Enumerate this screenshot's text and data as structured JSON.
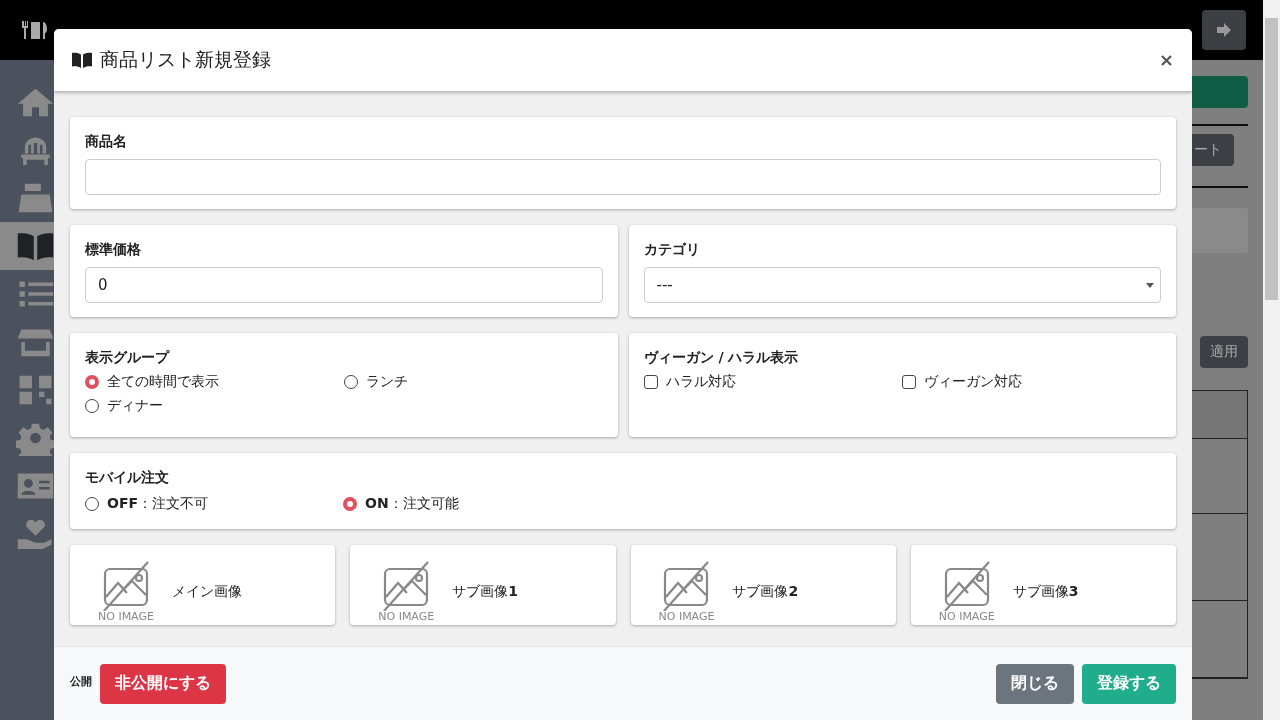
{
  "sidebar": {
    "items": [
      {
        "kind": "home",
        "selected": false
      },
      {
        "kind": "chair",
        "selected": false
      },
      {
        "kind": "register",
        "selected": false
      },
      {
        "kind": "book",
        "selected": true
      },
      {
        "kind": "list",
        "selected": false
      },
      {
        "kind": "store",
        "selected": false
      },
      {
        "kind": "qr",
        "selected": false
      },
      {
        "kind": "gear",
        "selected": false
      },
      {
        "kind": "card",
        "selected": false
      },
      {
        "kind": "heart",
        "selected": false
      }
    ]
  },
  "background": {
    "partial_button": "ート",
    "apply_button": "適用"
  },
  "modal": {
    "title": "商品リスト新規登録",
    "name_field": {
      "label": "商品名"
    },
    "price_field": {
      "label": "標準価格",
      "value": "0"
    },
    "category_field": {
      "label": "カテゴリ",
      "value": "---"
    },
    "display_group": {
      "label": "表示グループ",
      "options": [
        {
          "label": "全ての時間で表示",
          "selected": true
        },
        {
          "label": "ランチ",
          "selected": false
        },
        {
          "label": "ディナー",
          "selected": false
        }
      ]
    },
    "dietary": {
      "label": "ヴィーガン **/** ハラル表示",
      "options": [
        {
          "label": "ハラル対応",
          "checked": false
        },
        {
          "label": "ヴィーガン対応",
          "checked": false
        }
      ]
    },
    "mobile_order": {
      "label": "モバイル注文",
      "options": [
        {
          "label": "**OFF**：注文不可",
          "selected": false
        },
        {
          "label": "**ON**：注文可能",
          "selected": true
        }
      ]
    },
    "images": [
      {
        "label": "メイン画像",
        "no_image": "NO IMAGE"
      },
      {
        "label": "サブ画像**1**",
        "no_image": "NO IMAGE"
      },
      {
        "label": "サブ画像**2**",
        "no_image": "NO IMAGE"
      },
      {
        "label": "サブ画像**3**",
        "no_image": "NO IMAGE"
      }
    ],
    "footer": {
      "status_label": "公開",
      "unpublish_button": "非公開にする",
      "close_button": "閉じる",
      "submit_button": "登録する"
    }
  }
}
